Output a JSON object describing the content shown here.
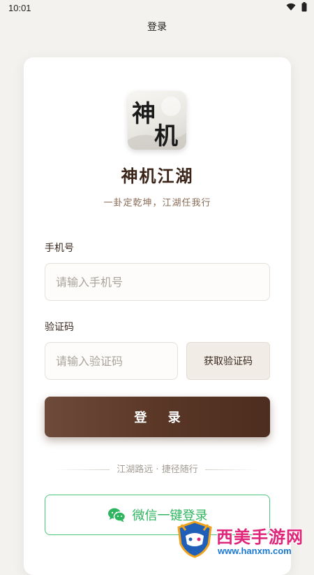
{
  "status_bar": {
    "time": "10:01"
  },
  "header": {
    "title": "登录"
  },
  "brand": {
    "logo_text": "神机",
    "title": "神机江湖",
    "slogan": "一卦定乾坤，江湖任我行"
  },
  "form": {
    "phone": {
      "label": "手机号",
      "placeholder": "请输入手机号"
    },
    "code": {
      "label": "验证码",
      "placeholder": "请输入验证码",
      "get_code_label": "获取验证码"
    },
    "login_label": "登 录"
  },
  "divider_text": "江湖路远 · 捷径随行",
  "wechat": {
    "label": "微信一键登录"
  },
  "watermark": {
    "title": "西美手游网",
    "url": "www.hanxm.com"
  },
  "colors": {
    "primary": "#5a3727",
    "wechat": "#2fb45f",
    "background": "#f4f2ee"
  }
}
